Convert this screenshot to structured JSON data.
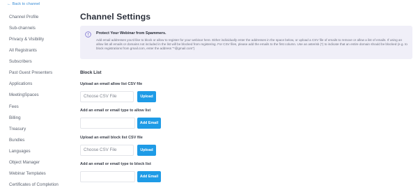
{
  "back_link": {
    "arrow": "←",
    "label": "Back to channel"
  },
  "sidebar": {
    "items": [
      {
        "label": "Channel Profile"
      },
      {
        "label": "Sub-channels"
      },
      {
        "label": "Privacy & Visibility"
      },
      {
        "label": "All Registrants"
      },
      {
        "label": "Subscribers"
      },
      {
        "label": "Past Guest Presenters"
      },
      {
        "label": "Applications"
      },
      {
        "label": "MeetingSpaces"
      },
      {
        "label": "Fees"
      },
      {
        "label": "Billing"
      },
      {
        "label": "Treasury"
      },
      {
        "label": "Bundles"
      },
      {
        "label": "Languages"
      },
      {
        "label": "Object Manager"
      },
      {
        "label": "Webinar Templates"
      },
      {
        "label": "Certificates of Completion"
      }
    ]
  },
  "main": {
    "title": "Channel Settings",
    "notice": {
      "icon": "info-icon",
      "title": "Protect Your Webinar from Spammers.",
      "body": "Add email addresses you'd like to block or allow to register for your webinar here. Either individually enter the addresses in the space below, or upload a CSV file of emails to remove or allow a list of emails. If using an allow list all emails or domains not included in the list will be blocked from registering. For CSV files, please add the emails to the first column. Use an asterisk (*) to indicate that an entire domain should be blocked (e.g. to block registrations from gmail.com, enter the address \"*@gmail.com\")"
    },
    "block_list": {
      "title": "Block List",
      "allow_csv": {
        "label": "Upload an email allow list CSV file",
        "input_text": "Choose CSV File",
        "button": "Upload"
      },
      "allow_email": {
        "label": "Add an email or email type to allow list",
        "value": "",
        "button": "Add Email"
      },
      "block_csv": {
        "label": "Upload an email block list CSV file",
        "input_text": "Choose CSV File",
        "button": "Upload"
      },
      "block_email": {
        "label": "Add an email or email type to block list",
        "value": "",
        "button": "Add Email"
      }
    }
  },
  "colors": {
    "accent": "#1e9be6",
    "notice_bg": "#f0eff8",
    "notice_icon": "#7b72d1",
    "link": "#3d8fd6"
  }
}
